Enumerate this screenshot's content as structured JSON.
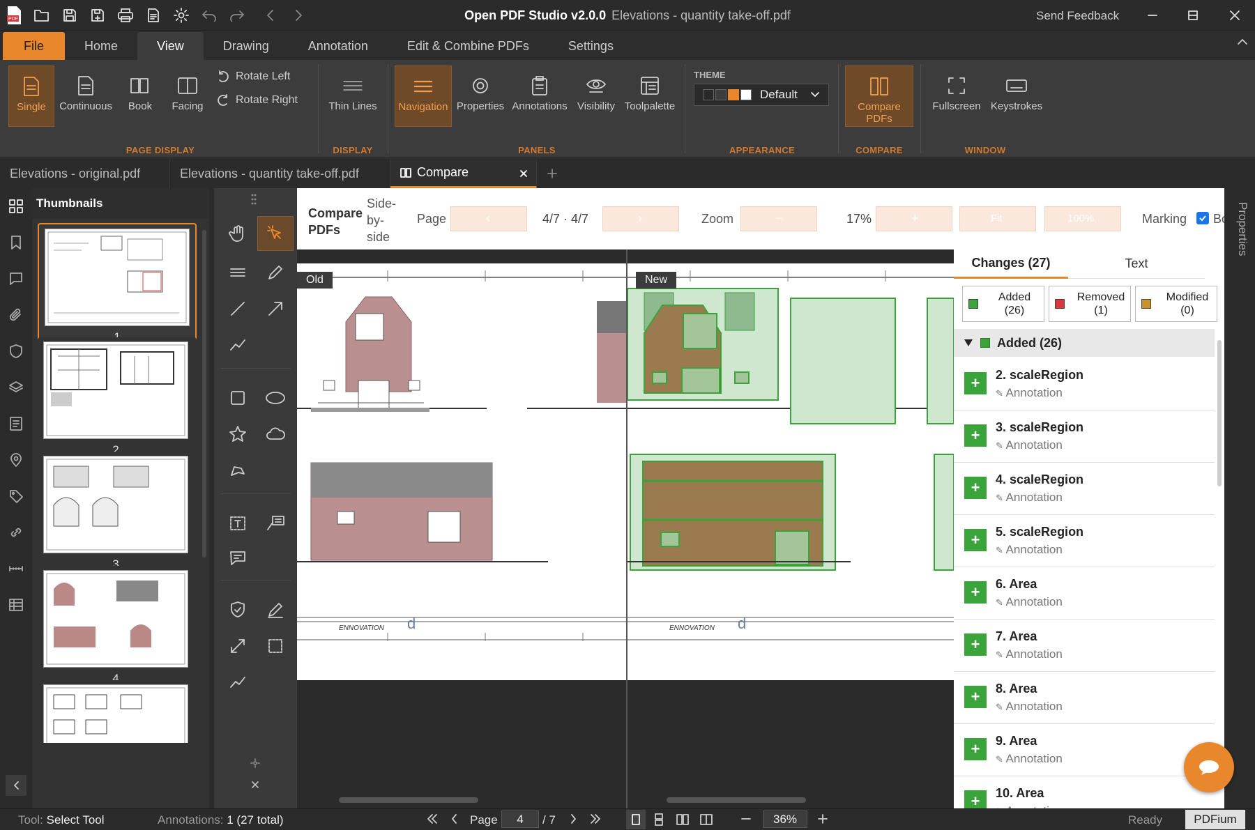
{
  "window": {
    "app_title": "Open PDF Studio v2.0.0",
    "doc_title": "Elevations - quantity take-off.pdf",
    "send_feedback": "Send Feedback"
  },
  "menu": {
    "tabs": [
      "File",
      "Home",
      "View",
      "Drawing",
      "Annotation",
      "Edit & Combine PDFs",
      "Settings"
    ],
    "active": "View"
  },
  "ribbon": {
    "page_display": {
      "label": "PAGE DISPLAY",
      "buttons": [
        "Single",
        "Continuous",
        "Book",
        "Facing"
      ],
      "rotate_left": "Rotate Left",
      "rotate_right": "Rotate Right"
    },
    "display": {
      "label": "DISPLAY",
      "buttons": [
        "Thin Lines"
      ]
    },
    "panels": {
      "label": "PANELS",
      "buttons": [
        "Navigation",
        "Properties",
        "Annotations",
        "Visibility",
        "Toolpalette"
      ]
    },
    "appearance": {
      "label": "APPEARANCE",
      "theme_label": "THEME",
      "theme_value": "Default"
    },
    "compare": {
      "label": "COMPARE",
      "button_line1": "Compare",
      "button_line2": "PDFs"
    },
    "window": {
      "label": "WINDOW",
      "buttons": [
        "Fullscreen",
        "Keystrokes"
      ]
    }
  },
  "doc_tabs": [
    "Elevations - original.pdf",
    "Elevations - quantity take-off.pdf",
    "Compare"
  ],
  "thumbnails": {
    "title": "Thumbnails",
    "pages": [
      "1",
      "2",
      "3",
      "4"
    ]
  },
  "compare_bar": {
    "title_line1": "Compare",
    "title_line2": "PDFs",
    "mode_line1": "Side-",
    "mode_line2": "by-",
    "mode_line3": "side",
    "page_label": "Page",
    "page_value": "4/7 · 4/7",
    "zoom_label": "Zoom",
    "zoom_value": "17%",
    "fit_label": "Fit",
    "pct_label": "100%",
    "marking_label": "Marking",
    "bo_label": "Bo"
  },
  "viewer": {
    "old_label": "Old",
    "new_label": "New"
  },
  "changes_panel": {
    "tab_changes": "Changes (27)",
    "tab_text": "Text",
    "filters": [
      {
        "line1": "Added",
        "line2": "(26)",
        "color": "#3aa43a"
      },
      {
        "line1": "Removed",
        "line2": "(1)",
        "color": "#d9363e"
      },
      {
        "line1": "Modified",
        "line2": "(0)",
        "color": "#c9922f"
      }
    ],
    "group_title": "Added (26)",
    "items": [
      {
        "name": "2. scaleRegion",
        "type": "Annotation"
      },
      {
        "name": "3. scaleRegion",
        "type": "Annotation"
      },
      {
        "name": "4. scaleRegion",
        "type": "Annotation"
      },
      {
        "name": "5. scaleRegion",
        "type": "Annotation"
      },
      {
        "name": "6. Area",
        "type": "Annotation"
      },
      {
        "name": "7. Area",
        "type": "Annotation"
      },
      {
        "name": "8. Area",
        "type": "Annotation"
      },
      {
        "name": "9. Area",
        "type": "Annotation"
      },
      {
        "name": "10. Area",
        "type": "Annotation"
      }
    ]
  },
  "properties_label": "Properties",
  "status": {
    "tool_label": "Tool:",
    "tool_value": "Select Tool",
    "annotations_label": "Annotations:",
    "annotations_value": "1 (27 total)",
    "page_label": "Page",
    "page_value": "4",
    "page_total": "/ 7",
    "zoom_value": "36%",
    "ready": "Ready",
    "engine": "PDFium"
  },
  "colors": {
    "accent": "#e8872b",
    "added": "#3aa43a",
    "removed": "#d9363e",
    "modified": "#c9922f"
  }
}
